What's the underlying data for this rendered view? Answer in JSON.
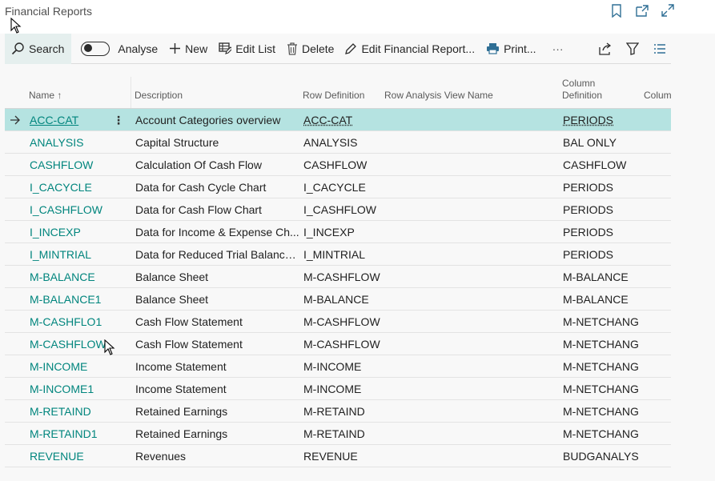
{
  "page": {
    "title": "Financial Reports"
  },
  "toolbar": {
    "search": "Search",
    "analyse": "Analyse",
    "new": "New",
    "edit_list": "Edit List",
    "delete": "Delete",
    "edit_report": "Edit Financial Report...",
    "print": "Print...",
    "more": "···"
  },
  "table": {
    "columns": {
      "name": "Name ↑",
      "description": "Description",
      "row_definition": "Row Definition",
      "row_analysis": "Row Analysis View Name",
      "column_definition_1": "Column",
      "column_definition_2": "Definition",
      "column_more": "Colum"
    },
    "rows": [
      {
        "name": "ACC-CAT",
        "description": "Account Categories overview",
        "row_def": "ACC-CAT",
        "col_def": "PERIODS"
      },
      {
        "name": "ANALYSIS",
        "description": "Capital Structure",
        "row_def": "ANALYSIS",
        "col_def": "BAL ONLY"
      },
      {
        "name": "CASHFLOW",
        "description": "Calculation Of Cash Flow",
        "row_def": "CASHFLOW",
        "col_def": "CASHFLOW"
      },
      {
        "name": "I_CACYCLE",
        "description": "Data for Cash Cycle Chart",
        "row_def": "I_CACYCLE",
        "col_def": "PERIODS"
      },
      {
        "name": "I_CASHFLOW",
        "description": "Data for Cash Flow Chart",
        "row_def": "I_CASHFLOW",
        "col_def": "PERIODS"
      },
      {
        "name": "I_INCEXP",
        "description": "Data for Income & Expense Ch...",
        "row_def": "I_INCEXP",
        "col_def": "PERIODS"
      },
      {
        "name": "I_MINTRIAL",
        "description": "Data for Reduced Trial Balance ...",
        "row_def": "I_MINTRIAL",
        "col_def": "PERIODS"
      },
      {
        "name": "M-BALANCE",
        "description": "Balance Sheet",
        "row_def": "M-CASHFLOW",
        "col_def": "M-BALANCE"
      },
      {
        "name": "M-BALANCE1",
        "description": "Balance Sheet",
        "row_def": "M-BALANCE",
        "col_def": "M-BALANCE"
      },
      {
        "name": "M-CASHFLO1",
        "description": "Cash Flow Statement",
        "row_def": "M-CASHFLOW",
        "col_def": "M-NETCHANG"
      },
      {
        "name": "M-CASHFLOW",
        "description": "Cash Flow Statement",
        "row_def": "M-CASHFLOW",
        "col_def": "M-NETCHANG"
      },
      {
        "name": "M-INCOME",
        "description": "Income Statement",
        "row_def": "M-INCOME",
        "col_def": "M-NETCHANG"
      },
      {
        "name": "M-INCOME1",
        "description": "Income Statement",
        "row_def": "M-INCOME",
        "col_def": "M-NETCHANG"
      },
      {
        "name": "M-RETAIND",
        "description": "Retained Earnings",
        "row_def": "M-RETAIND",
        "col_def": "M-NETCHANG"
      },
      {
        "name": "M-RETAIND1",
        "description": "Retained Earnings",
        "row_def": "M-RETAIND",
        "col_def": "M-NETCHANG"
      },
      {
        "name": "REVENUE",
        "description": "Revenues",
        "row_def": "REVENUE",
        "col_def": "BUDGANALYS"
      }
    ],
    "selected_index": 0
  },
  "colors": {
    "accent": "#00857d",
    "selected_row": "#b5e3e1",
    "search_bg": "#e5efee"
  }
}
